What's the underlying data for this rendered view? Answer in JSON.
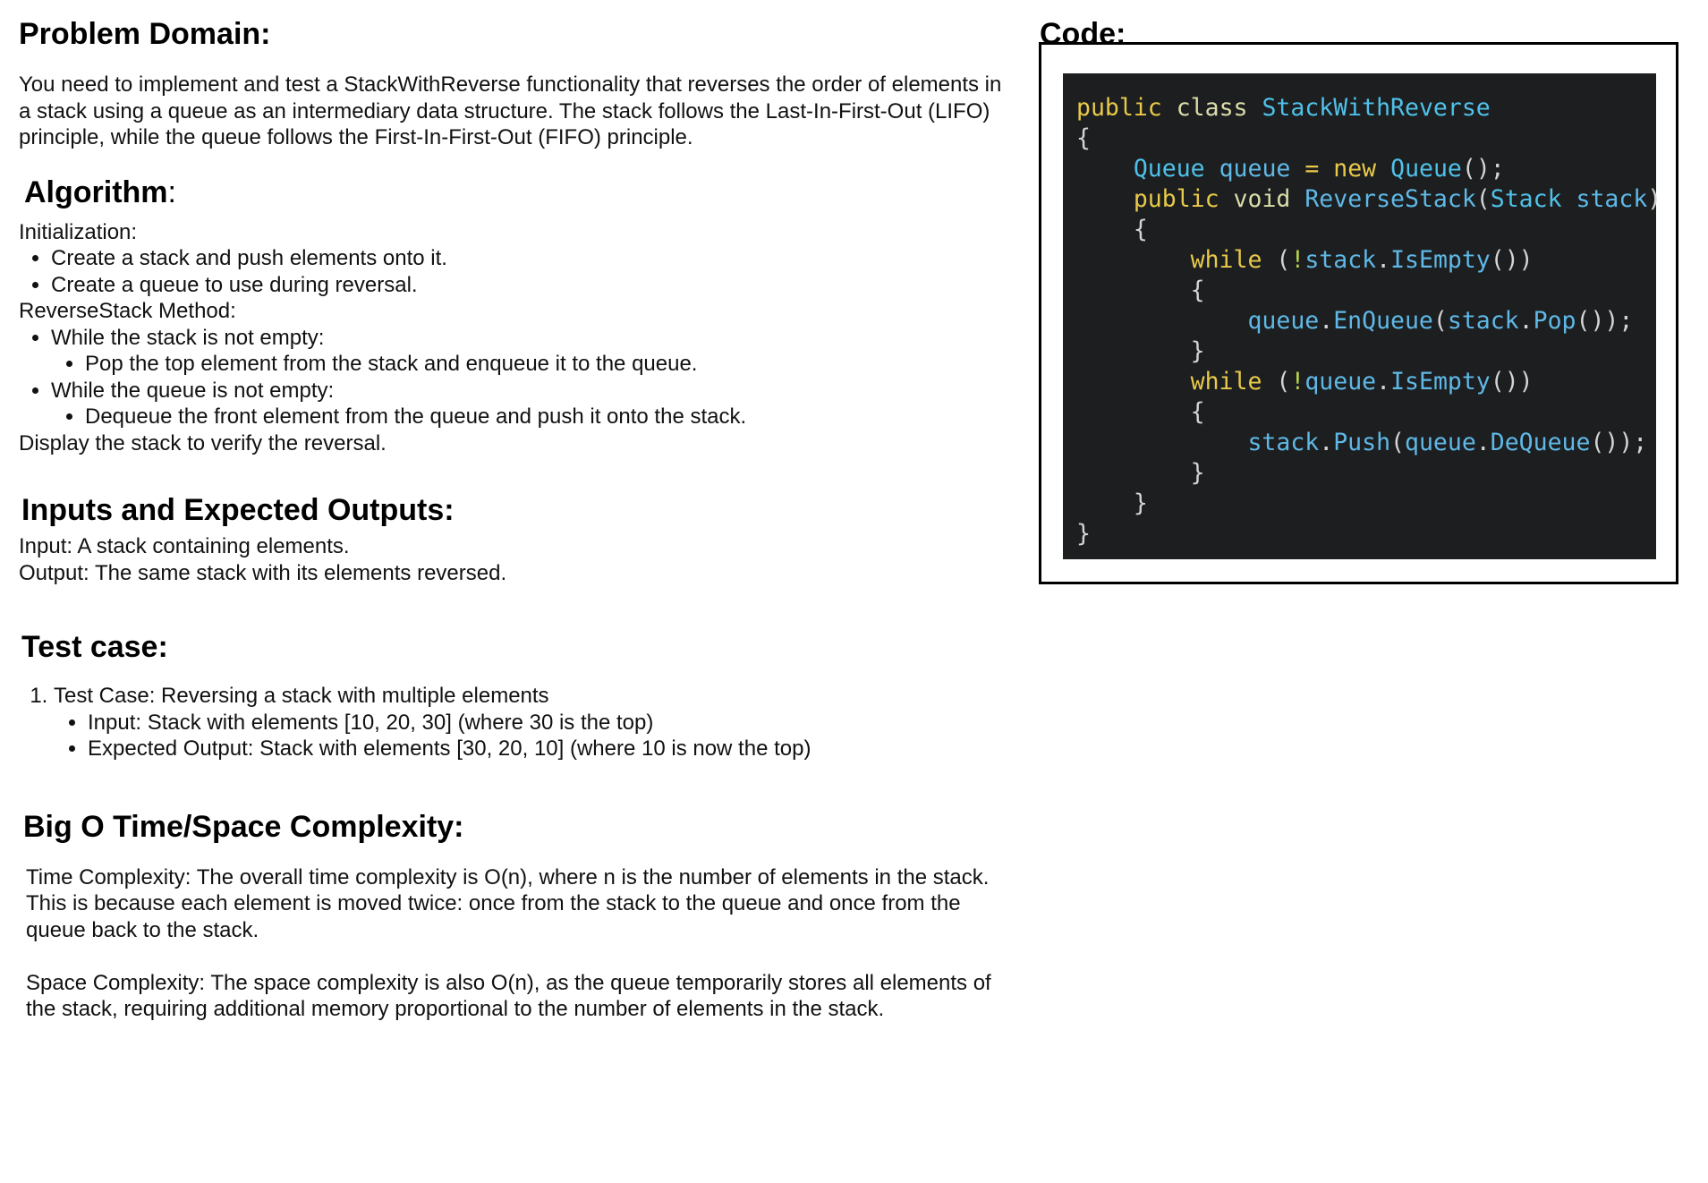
{
  "problem_domain": {
    "heading": "Problem Domain:",
    "text": "You need to implement and test a StackWithReverse functionality that reverses the order of elements in a stack using a queue as an intermediary data structure. The stack follows the Last-In-First-Out (LIFO) principle, while the queue follows the First-In-First-Out (FIFO) principle."
  },
  "algorithm": {
    "heading": "Algorithm",
    "heading_suffix": ":",
    "init_label": "Initialization:",
    "init_items": [
      "Create a stack and push elements onto it.",
      "Create a queue to use during reversal."
    ],
    "method_label": "ReverseStack Method:",
    "method_items": [
      {
        "text": "While the stack is not empty:",
        "sub": "Pop the top element from the stack and enqueue it to the queue."
      },
      {
        "text": "While the queue is not empty:",
        "sub": "Dequeue the front element from the queue and push it onto the stack."
      }
    ],
    "display_line": "Display the stack to verify the reversal."
  },
  "io": {
    "heading": "Inputs and Expected Outputs:",
    "input": "Input: A stack containing elements.",
    "output": "Output: The same stack with its elements reversed."
  },
  "test_case": {
    "heading": "Test case:",
    "cases": [
      {
        "title": "Test Case: Reversing a stack with multiple elements",
        "input": "Input: Stack with elements [10, 20, 30] (where 30 is the top)",
        "expected": "Expected Output: Stack with elements [30, 20, 10] (where 10 is now the top)"
      }
    ]
  },
  "big_o": {
    "heading": "Big O Time/Space Complexity:",
    "time": "Time Complexity: The overall time complexity is O(n), where n is the number of elements in the stack. This is because each element is moved twice: once from the stack to the queue and once from the queue back to the stack.",
    "space": "Space Complexity: The space complexity is also O(n), as the queue temporarily stores all elements of the stack, requiring additional memory proportional to the number of elements in the stack."
  },
  "code": {
    "heading": "Code:",
    "line1": {
      "public": "public",
      "class": "class",
      "name": "StackWithReverse"
    },
    "line3": {
      "type": "Queue",
      "var": "queue",
      "eq": "=",
      "new": "new",
      "ctor": "Queue",
      "tail": "();"
    },
    "line4": {
      "public": "public",
      "void": "void",
      "method": "ReverseStack",
      "param_type": "Stack",
      "param": "stack"
    },
    "loop1": {
      "while": "while",
      "bang": "!",
      "obj": "stack",
      "call": "IsEmpty",
      "body_obj": "queue",
      "body_call": "EnQueue",
      "arg_obj": "stack",
      "arg_call": "Pop"
    },
    "loop2": {
      "while": "while",
      "bang": "!",
      "obj": "queue",
      "call": "IsEmpty",
      "body_obj": "stack",
      "body_call": "Push",
      "arg_obj": "queue",
      "arg_call": "DeQueue"
    },
    "open_brace": "{",
    "close_brace": "}"
  }
}
